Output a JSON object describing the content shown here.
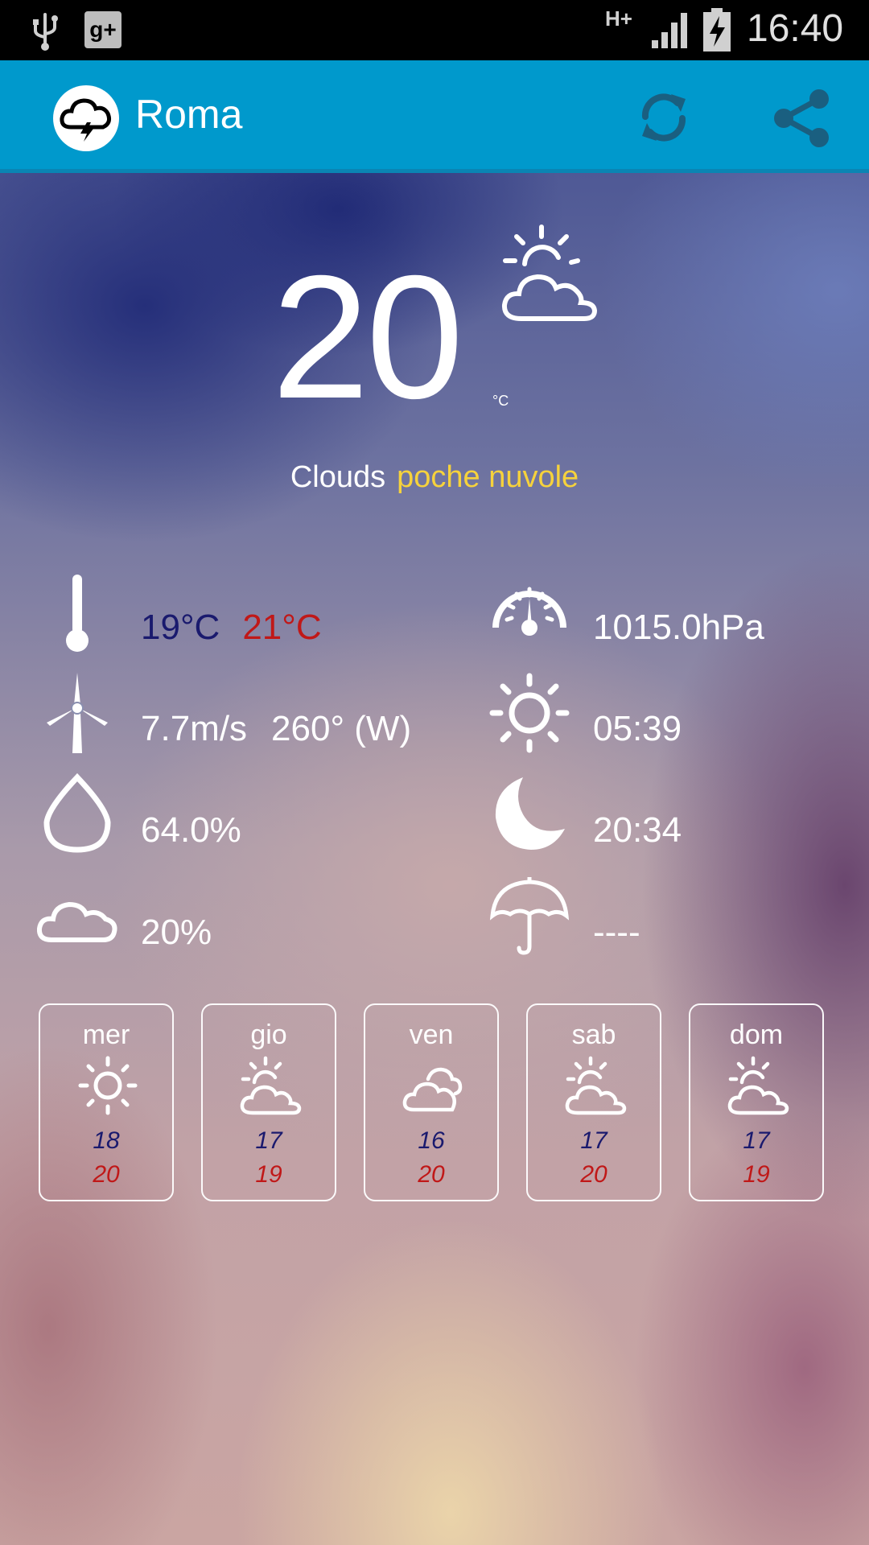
{
  "status_bar": {
    "network": "H+",
    "time": "16:40"
  },
  "header": {
    "city": "Roma"
  },
  "current": {
    "temperature": "20",
    "unit": "°C",
    "condition_en": "Clouds",
    "condition_it": "poche nuvole"
  },
  "details": {
    "temp_min": "19°C",
    "temp_max": "21°C",
    "wind_speed": "7.7m/s",
    "wind_direction": "260° (W)",
    "humidity": "64.0%",
    "cloudiness": "20%",
    "pressure": "1015.0hPa",
    "sunrise": "05:39",
    "sunset": "20:34",
    "rain": "----"
  },
  "forecast": [
    {
      "day": "mer",
      "icon": "sun-icon",
      "min": "18",
      "max": "20"
    },
    {
      "day": "gio",
      "icon": "sun-cloud-icon",
      "min": "17",
      "max": "19"
    },
    {
      "day": "ven",
      "icon": "clouds-icon",
      "min": "16",
      "max": "20"
    },
    {
      "day": "sab",
      "icon": "sun-cloud-icon",
      "min": "17",
      "max": "20"
    },
    {
      "day": "dom",
      "icon": "sun-cloud-icon",
      "min": "17",
      "max": "19"
    }
  ],
  "colors": {
    "action_bar": "#0099cc",
    "min_temp": "#1a1a6e",
    "max_temp": "#c01818",
    "condition_it": "#f6d23c"
  }
}
